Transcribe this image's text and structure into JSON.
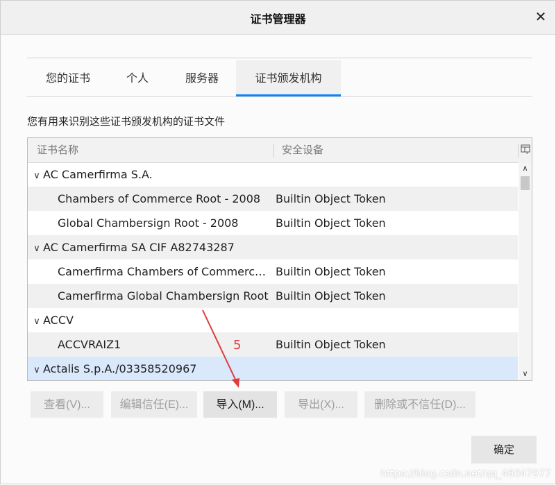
{
  "window": {
    "title": "证书管理器",
    "close_label": "✕"
  },
  "tabs": [
    {
      "label": "您的证书",
      "active": false
    },
    {
      "label": "个人",
      "active": false
    },
    {
      "label": "服务器",
      "active": false
    },
    {
      "label": "证书颁发机构",
      "active": true
    }
  ],
  "description": "您有用来识别这些证书颁发机构的证书文件",
  "tree": {
    "columns": [
      "证书名称",
      "安全设备"
    ],
    "rows": [
      {
        "type": "group",
        "name": "AC Camerfirma S.A.",
        "device": "",
        "expanded": true
      },
      {
        "type": "item",
        "name": "Chambers of Commerce Root - 2008",
        "device": "Builtin Object Token"
      },
      {
        "type": "item",
        "name": "Global Chambersign Root - 2008",
        "device": "Builtin Object Token"
      },
      {
        "type": "group",
        "name": "AC Camerfirma SA CIF A82743287",
        "device": "",
        "expanded": true
      },
      {
        "type": "item",
        "name": "Camerfirma Chambers of Commerce...",
        "device": "Builtin Object Token"
      },
      {
        "type": "item",
        "name": "Camerfirma Global Chambersign Root",
        "device": "Builtin Object Token"
      },
      {
        "type": "group",
        "name": "ACCV",
        "device": "",
        "expanded": true
      },
      {
        "type": "item",
        "name": "ACCVRAIZ1",
        "device": "Builtin Object Token"
      },
      {
        "type": "group",
        "name": "Actalis S.p.A./03358520967",
        "device": "",
        "expanded": true,
        "selected": true
      }
    ]
  },
  "buttons": {
    "view": "查看(V)...",
    "edit_trust": "编辑信任(E)...",
    "import": "导入(M)...",
    "export": "导出(X)...",
    "delete": "删除或不信任(D)...",
    "ok": "确定"
  },
  "annotation": {
    "number": "5",
    "color": "#e03a3a"
  },
  "watermark": "https://blog.csdn.net/qq_46047977",
  "colors": {
    "accent": "#0a84ff",
    "selected_row": "#d9e8fb"
  }
}
